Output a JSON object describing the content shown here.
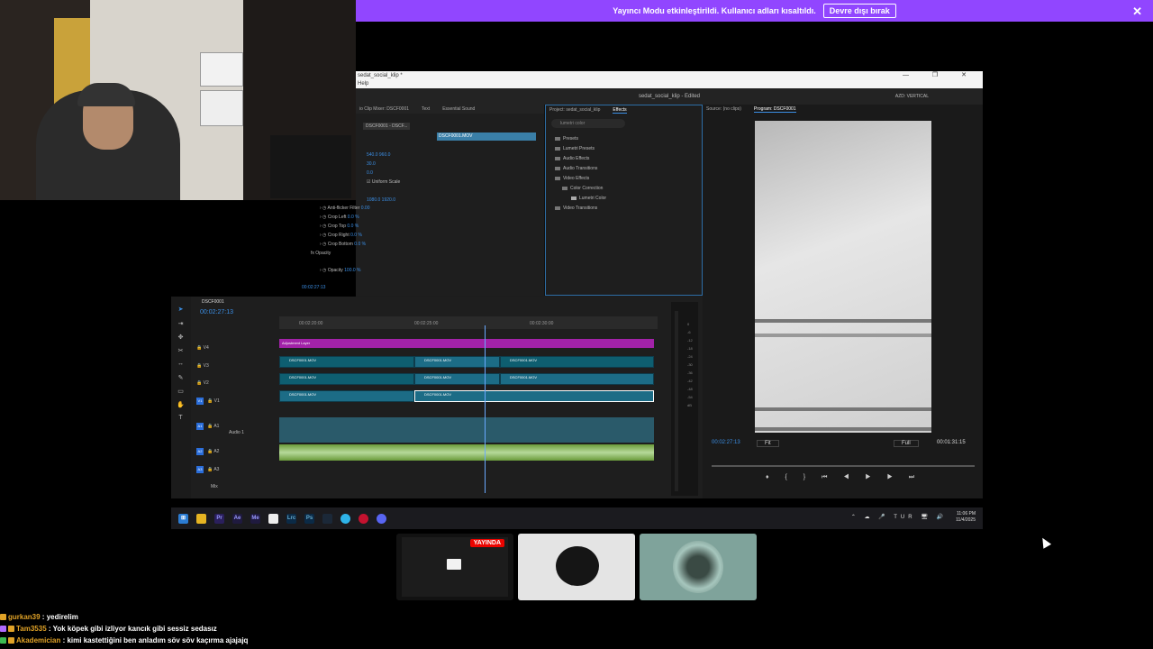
{
  "banner": {
    "message": "Yayıncı Modu etkinleştirildi. Kullanıcı adları kısaltıldı.",
    "button": "Devre dışı bırak",
    "close": "✕"
  },
  "premiere": {
    "window_title": "sedat_social_klip *",
    "menu": "Help",
    "app_title": "sedat_social_klip - Edited",
    "workspace": "AZD: VERTICAL",
    "window_controls": "— ❐ ✕",
    "panel_tabs": [
      "io Clip Mixer: DSCF0001",
      "Text",
      "Essential Sound"
    ],
    "project_tabs": [
      "Project: sedat_social_klip",
      "Effects"
    ],
    "monitor_tabs": [
      "Source: (no clips)",
      "Program: DSCF0001"
    ],
    "effect_controls": {
      "clip_tab": "DSCF0001 - DSCF...",
      "clip_name": "DSCF0001.MOV",
      "rows": [
        {
          "label": "",
          "value": "540.0    960.0"
        },
        {
          "label": "",
          "value": "30.0"
        },
        {
          "label": "",
          "value": "0.0"
        },
        {
          "label": "Uniform Scale",
          "value": ""
        },
        {
          "label": "",
          "value": "1080.0   1920.0"
        },
        {
          "label": "Anti-flicker Filter",
          "value": "0.00"
        },
        {
          "label": "Crop Left",
          "value": "0.0 %"
        },
        {
          "label": "Crop Top",
          "value": "0.0 %"
        },
        {
          "label": "Crop Right",
          "value": "0.0 %"
        },
        {
          "label": "Crop Bottom",
          "value": "0.0 %"
        },
        {
          "label": "fx  Opacity",
          "value": ""
        },
        {
          "label": "Opacity",
          "value": "100.0 %"
        }
      ],
      "timecode": "00:02:27:13"
    },
    "effects_panel": {
      "search_placeholder": "lumetri color",
      "items": [
        "Presets",
        "Lumetri Presets",
        "Audio Effects",
        "Audio Transitions",
        "Video Effects",
        "Color Correction",
        "Lumetri Color",
        "Video Transitions"
      ]
    },
    "timeline": {
      "sequence": "DSCF0001",
      "timecode": "00:02:27:13",
      "ruler": [
        "00:02:20:00",
        "00:02:25:00",
        "00:02:30:00"
      ],
      "tracks_video": [
        "V4",
        "V3",
        "V2",
        "V1"
      ],
      "tracks_audio": [
        "A1",
        "A2",
        "A3"
      ],
      "audio_label": "Audio 1",
      "mix_label": "Mix",
      "adjustment_layer": "Adjustment Layer",
      "clip_label": "DSCF0001.MOV"
    },
    "program_monitor": {
      "timecode": "00:02:27:13",
      "fit": "Fit",
      "quality": "Full",
      "duration": "00:01:31:15"
    },
    "meter_ticks": [
      "0",
      "-6",
      "-12",
      "-18",
      "-24",
      "-30",
      "-36",
      "-42",
      "-48",
      "-54",
      "dB"
    ]
  },
  "taskbar": {
    "icons": [
      "Windows",
      "Explorer",
      "Pr",
      "Ae",
      "Me",
      "Files",
      "Lrc",
      "Ps",
      "Steam",
      "Edge",
      "App",
      "Discord"
    ],
    "lang": "TUR",
    "time": "11:06 PM",
    "date": "11/4/2025"
  },
  "stage": {
    "live_badge": "YAYINDA"
  },
  "chat": [
    {
      "user": "gurkan39",
      "text": "yedirelim",
      "color": "#e0a227",
      "badge": "y"
    },
    {
      "user": "Tam3535",
      "text": "Yok köpek gibi izliyor kancık gibi sessiz sedasız",
      "color": "#e0a227",
      "badge": "y"
    },
    {
      "user": "Akademician",
      "text": "kimi kastettiğini ben anladım söv söv kaçırma ajajajq",
      "color": "#e0a227",
      "badge": "g"
    }
  ],
  "colors": {
    "banner": "#9146ff",
    "accent_blue": "#3b8fe6",
    "live_red": "#eb0400",
    "adjustment_clip": "#a222a8",
    "video_clip": "#1c6c86"
  }
}
